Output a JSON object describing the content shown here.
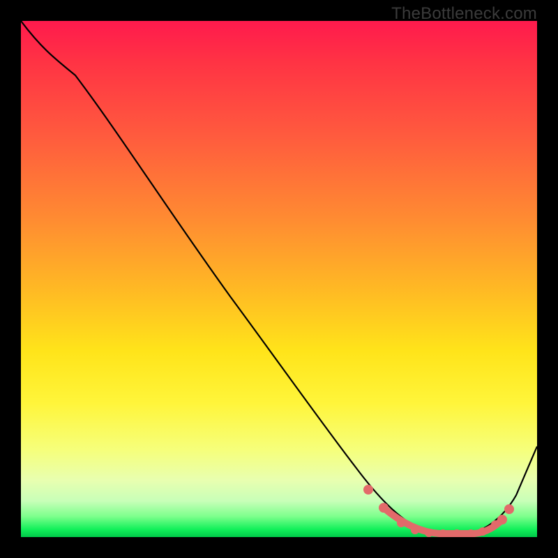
{
  "watermark": "TheBottleneck.com",
  "chart_data": {
    "type": "line",
    "title": "",
    "xlabel": "",
    "ylabel": "",
    "xlim": [
      0,
      100
    ],
    "ylim": [
      0,
      100
    ],
    "series": [
      {
        "name": "bottleneck-curve",
        "x": [
          0,
          5,
          12,
          20,
          30,
          40,
          50,
          58,
          64,
          68,
          72,
          76,
          80,
          84,
          88,
          92,
          96,
          100
        ],
        "y": [
          100,
          95,
          90,
          80,
          67,
          54,
          41,
          30,
          20,
          12,
          6,
          2,
          0,
          0,
          0,
          3,
          10,
          22
        ]
      }
    ],
    "highlight_points": {
      "name": "optimal-range-markers",
      "x": [
        66,
        70,
        73,
        75,
        77,
        79,
        81,
        83,
        85,
        87,
        90,
        92
      ],
      "y": [
        11,
        5,
        2,
        1,
        0.5,
        0,
        0,
        0,
        0,
        0.5,
        2,
        5
      ]
    }
  }
}
